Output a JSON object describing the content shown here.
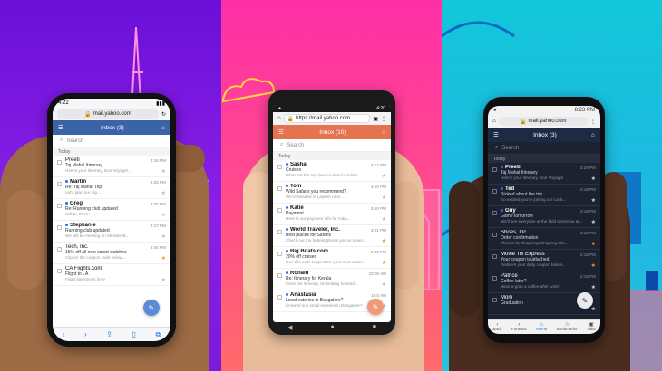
{
  "colors": {
    "panel_left": "#7b19dc",
    "panel_mid": "#ff4a8d",
    "panel_right": "#1fb6e2",
    "ios_header": "#3b63a8",
    "android_header": "#e6734f",
    "dark_header": "#1d2a44",
    "fab_ios": "#5b8bd8",
    "fab_android": "#f09a7a",
    "fab_dark": "#e9e9ee",
    "star_on": "#f7931e"
  },
  "phone1": {
    "status_time": "4:22",
    "url": "mail.yahoo.com",
    "inbox_label": "Inbox (3)",
    "search_placeholder": "Search",
    "section": "Today",
    "messages": [
      {
        "sender": "Preeti",
        "time": "4:18 PM",
        "subject": "Taj Mahal Itinerary",
        "preview": "Here's your itinerary, Bon Voyage!...",
        "unread": false,
        "starred": false
      },
      {
        "sender": "Martin",
        "time": "3:25 PM",
        "subject": "Re: Taj Mahal Trip",
        "preview": "Let's plan our trip...",
        "unread": true,
        "starred": false
      },
      {
        "sender": "Greg",
        "time": "3:20 PM",
        "subject": "Re: Running club updated",
        "preview": "Will be there!",
        "unread": true,
        "starred": false
      },
      {
        "sender": "Stephanie",
        "time": "3:17 PM",
        "subject": "Running club updated",
        "preview": "We will be meeting on Minister B...",
        "unread": true,
        "starred": false
      },
      {
        "sender": "Tech, Inc.",
        "time": "3:00 PM",
        "subject": "15% off all new smart watches",
        "preview": "Clip on the coupon code below...",
        "unread": false,
        "starred": true
      },
      {
        "sender": "CA Flights.com",
        "time": "",
        "subject": "Flight to LA",
        "preview": "Flight itinerary is here",
        "unread": false,
        "starred": false
      }
    ],
    "toolbar_icons": [
      "back-icon",
      "forward-icon",
      "share-icon",
      "bookmarks-icon",
      "tabs-icon"
    ]
  },
  "phone2": {
    "status_time": "4:20",
    "url": "https://mail.yahoo.com",
    "inbox_label": "Inbox (10)",
    "search_placeholder": "Search",
    "section": "Today",
    "messages": [
      {
        "sender": "Sasha",
        "time": "4:12 PM",
        "subject": "Cruises",
        "preview": "What are the top river cruises to India?",
        "unread": true,
        "starred": false
      },
      {
        "sender": "Tom",
        "time": "4:10 PM",
        "subject": "Wild Safaris you recommend?",
        "preview": "We're headed to Ladakh next...",
        "unread": true,
        "starred": false
      },
      {
        "sender": "Katie",
        "time": "3:50 PM",
        "subject": "Payment",
        "preview": "Here is our payment info for India...",
        "unread": true,
        "starred": false
      },
      {
        "sender": "World Traveler, Inc.",
        "time": "3:01 PM",
        "subject": "Best places for Safaris",
        "preview": "Check out the hottest places you've never...",
        "unread": true,
        "starred": true
      },
      {
        "sender": "Big Boats.com",
        "time": "2:00 PM",
        "subject": "20% off cruises",
        "preview": "Use this code to get 20% your next cruise...",
        "unread": true,
        "starred": true
      },
      {
        "sender": "Ronald",
        "time": "10:00 AM",
        "subject": "Re: Itinerary for Kerala",
        "preview": "I love the itinerary I'm looking forward...",
        "unread": true,
        "starred": false
      },
      {
        "sender": "Anastasia",
        "time": "10:0 AM",
        "subject": "Local eateries in Bangalore?",
        "preview": "Know of any small eateries in Bangalore?",
        "unread": true,
        "starred": false
      }
    ]
  },
  "phone3": {
    "status_time": "8:23 PM",
    "url": "mail.yahoo.com",
    "inbox_label": "Inbox (3)",
    "search_placeholder": "Search",
    "section": "Today",
    "messages": [
      {
        "sender": "Preeti",
        "time": "3:20 PM",
        "subject": "Taj Mahal Itinerary",
        "preview": "Here's your itinerary, Bon Voyage!",
        "unread": true,
        "starred": false
      },
      {
        "sender": "Ted",
        "time": "3:18 PM",
        "subject": "Stoked about the trip",
        "preview": "So excited you're joining us! Look...",
        "unread": true,
        "starred": false
      },
      {
        "sender": "Guy",
        "time": "3:15 PM",
        "subject": "Game tomorrow",
        "preview": "We'll see everyone at the field tomorrow at...",
        "unread": true,
        "starred": false
      },
      {
        "sender": "Shoes, Inc.",
        "time": "3:15 PM",
        "subject": "Order confirmation",
        "preview": "Thanks for shopping! Shipping info...",
        "unread": false,
        "starred": true
      },
      {
        "sender": "Movie Tix Express",
        "time": "2:15 PM",
        "subject": "Your coupon is attached",
        "preview": "Redeem your daily coupon below...",
        "unread": false,
        "starred": true
      },
      {
        "sender": "Patrice",
        "time": "2:15 PM",
        "subject": "Coffee later?",
        "preview": "Wanna grab a coffee after work?",
        "unread": false,
        "starred": false
      },
      {
        "sender": "Mom",
        "time": "",
        "subject": "Graduation",
        "preview": "",
        "unread": false,
        "starred": false
      }
    ],
    "toolbar": [
      {
        "label": "Back",
        "icon": "back-icon"
      },
      {
        "label": "Forward",
        "icon": "forward-icon"
      },
      {
        "label": "Home",
        "icon": "home-icon"
      },
      {
        "label": "Bookmarks",
        "icon": "bookmarks-icon"
      },
      {
        "label": "Tabs",
        "icon": "tabs-icon"
      }
    ]
  }
}
